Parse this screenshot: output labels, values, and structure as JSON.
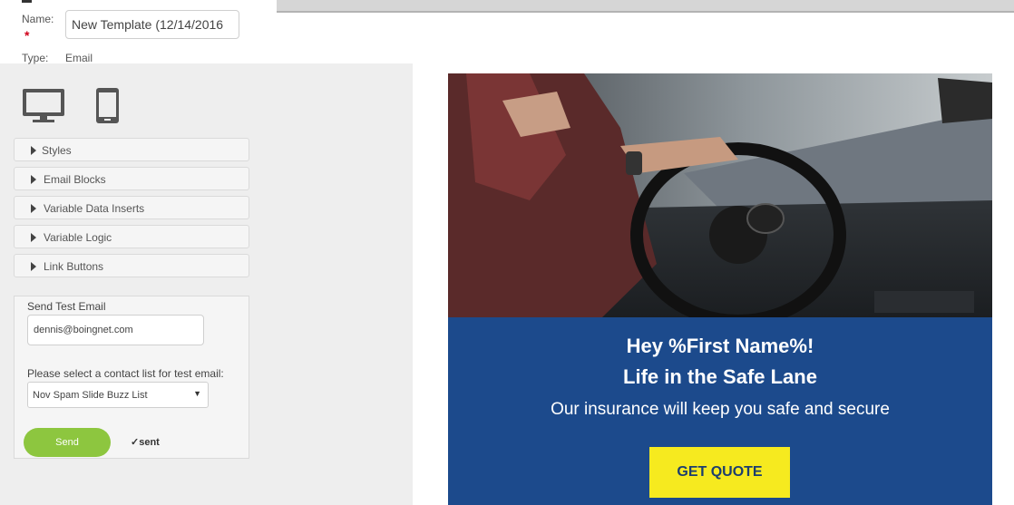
{
  "template": {
    "name_label": "Name:",
    "required_mark": "*",
    "name_value": "New Template (12/14/2016",
    "type_label": "Type:",
    "type_value": "Email"
  },
  "devices": [
    "desktop-icon",
    "mobile-icon"
  ],
  "accordions": [
    {
      "label": "Styles"
    },
    {
      "label": "Email Blocks"
    },
    {
      "label": "Variable Data Inserts"
    },
    {
      "label": "Variable Logic"
    },
    {
      "label": "Link Buttons"
    }
  ],
  "test_email": {
    "title": "Send Test Email",
    "email_value": "dennis@boingnet.com",
    "list_label": "Please select a contact list for test email:",
    "list_selected": "Nov Spam Slide Buzz List",
    "send_label": "Send",
    "sent_check": "✓",
    "sent_label": "sent"
  },
  "preview": {
    "headline1": "Hey %First Name%!",
    "headline2": "Life in the Safe Lane",
    "subline": "Our insurance will keep you safe and secure",
    "cta_label": "GET QUOTE",
    "banner_color": "#1c4a8c",
    "cta_color": "#f6ea1f"
  }
}
